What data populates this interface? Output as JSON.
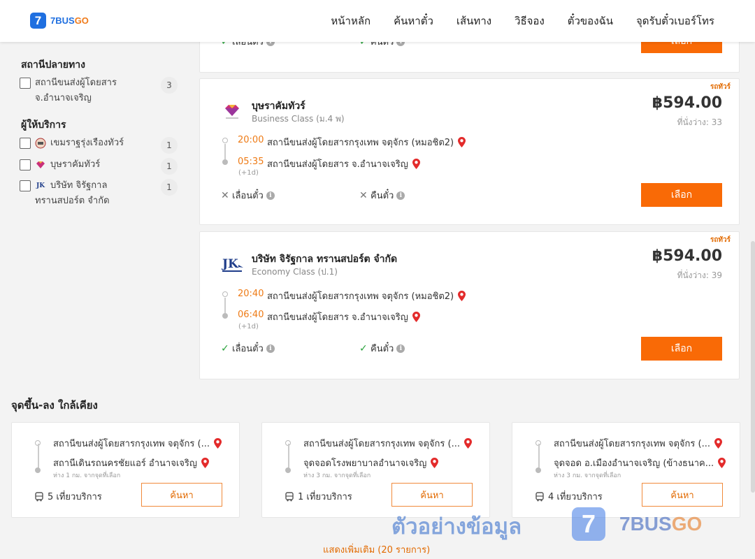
{
  "brand": {
    "logo_glyph": "7",
    "name_a": "7BUS",
    "name_b": "GO",
    "color": "#1f6fe0",
    "accent": "#f96a06"
  },
  "nav": [
    "หน้าหลัก",
    "ค้นหาตั๋ว",
    "เส้นทาง",
    "วิธีจอง",
    "ตั๋วของฉัน",
    "จุดรับตั๋วเบอร์โทร"
  ],
  "sidebar": {
    "destination_title": "สถานีปลายทาง",
    "destinations": [
      {
        "label_1": "สถานีขนส่งผู้โดยสาร",
        "label_2": "จ.อำนาจเจริญ",
        "count": "3"
      }
    ],
    "operator_title": "ผู้ให้บริการ",
    "operators": [
      {
        "label_1": "เขมราฐรุ่งเรืองทัวร์",
        "label_2": "",
        "count": "1",
        "icon": "operator-icon"
      },
      {
        "label_1": "บุษราคัมทัวร์",
        "label_2": "",
        "count": "1",
        "icon": "diamond-icon"
      },
      {
        "label_1": "บริษัท จิรัฐกาล",
        "label_2": "ทรานสปอร์ต จำกัด",
        "count": "1",
        "icon": "jk-icon"
      }
    ]
  },
  "prev_card": {
    "reschedule": "เลื่อนตั๋ว",
    "refund": "คืนตั๋ว",
    "select": "เลือก"
  },
  "trips": [
    {
      "tag": "รถทัวร์",
      "operator": "บุษราคัมทัวร์",
      "class": "Business Class (ม.4 พ)",
      "price": "฿594.00",
      "seats": "ที่นั่งว่าง: 33",
      "dep_time": "20:00",
      "dep_station": "สถานีขนส่งผู้โดยสารกรุงเทพ จตุจักร (หมอชิต2)",
      "arr_time": "05:35",
      "arr_station": "สถานีขนส่งผู้โดยสาร จ.อำนาจเจริญ",
      "next_day": "(+1d)",
      "reschedule": "เลื่อนตั๋ว",
      "reschedule_ok": false,
      "refund": "คืนตั๋ว",
      "refund_ok": false,
      "select": "เลือก",
      "logo": "diamond-logo"
    },
    {
      "tag": "รถทัวร์",
      "operator": "บริษัท จิรัฐกาล ทรานสปอร์ต จำกัด",
      "class": "Economy Class (ป.1)",
      "price": "฿594.00",
      "seats": "ที่นั่งว่าง: 39",
      "dep_time": "20:40",
      "dep_station": "สถานีขนส่งผู้โดยสารกรุงเทพ จตุจักร (หมอชิต2)",
      "arr_time": "06:40",
      "arr_station": "สถานีขนส่งผู้โดยสาร จ.อำนาจเจริญ",
      "next_day": "(+1d)",
      "reschedule": "เลื่อนตั๋ว",
      "reschedule_ok": true,
      "refund": "คืนตั๋ว",
      "refund_ok": true,
      "select": "เลือก",
      "logo": "jk-logo"
    }
  ],
  "nearby": {
    "title": "จุดขึ้น-ลง ใกล้เคียง",
    "items": [
      {
        "from": "สถานีขนส่งผู้โดยสารกรุงเทพ จตุจักร (...",
        "to": "สถานีเดินรถนครชัยแอร์ อำนาจเจริญ",
        "dist": "ห่าง 1 กม. จากจุดที่เลือก",
        "trips": "5 เที่ยวบริการ",
        "button": "ค้นหา"
      },
      {
        "from": "สถานีขนส่งผู้โดยสารกรุงเทพ จตุจักร (...",
        "to": "จุดจอดโรงพยาบาลอำนาจเจริญ",
        "dist": "ห่าง 3 กม. จากจุดที่เลือก",
        "trips": "1 เที่ยวบริการ",
        "button": "ค้นหา"
      },
      {
        "from": "สถานีขนส่งผู้โดยสารกรุงเทพ จตุจักร (...",
        "to": "จุดจอด อ.เมืองอำนาจเจริญ (ข้างธนาค...",
        "dist": "ห่าง 3 กม. จากจุดที่เลือก",
        "trips": "4 เที่ยวบริการ",
        "button": "ค้นหา"
      }
    ]
  },
  "watermark": {
    "text": "ตัวอย่างข้อมูล",
    "logo_glyph": "7",
    "brand_a": "7BUS",
    "brand_b": "GO"
  },
  "show_more": "แสดงเพิ่มเติม (20 รายการ)"
}
